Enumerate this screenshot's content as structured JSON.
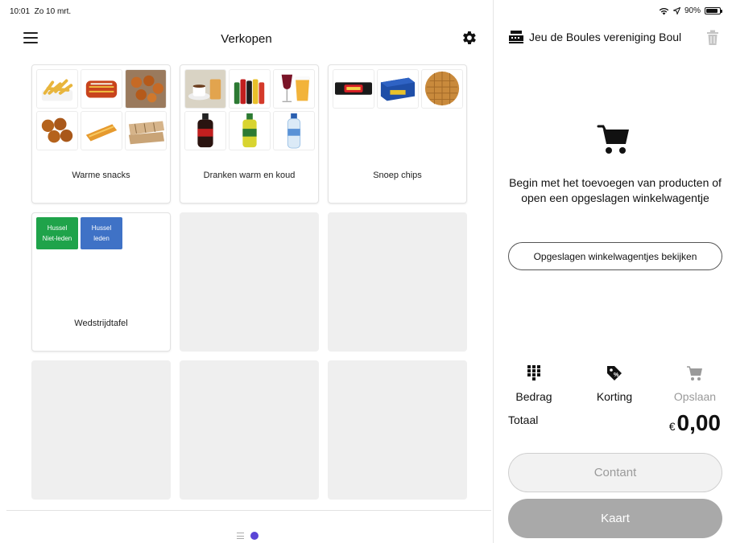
{
  "status_bar": {
    "time": "10:01",
    "date": "Zo 10 mrt.",
    "battery_text": "90%",
    "icons": [
      "wifi-icon",
      "location-arrow-icon",
      "battery-icon"
    ]
  },
  "header": {
    "title": "Verkopen",
    "menu_icon": "hamburger-icon",
    "settings_icon": "gear-icon"
  },
  "categories": [
    {
      "label": "Warme snacks",
      "thumbnails": [
        "fries",
        "frikandel-speciaal",
        "nuggets",
        "bitterballen",
        "kaassouffle",
        "tosti"
      ]
    },
    {
      "label": "Dranken warm en koud",
      "thumbnails": [
        "coffee-tea",
        "soda-bottles",
        "wine-beer",
        "cola-bottle",
        "water-bottle",
        "spa-water"
      ]
    },
    {
      "label": "Snoep chips",
      "thumbnails": [
        "mars-bar",
        "candy-box",
        "stroopwafel"
      ]
    },
    {
      "label": "Wedstrijdtafel",
      "buttons": [
        {
          "line1": "Hussel",
          "line2": "Niet-leden",
          "color": "#1fa34a"
        },
        {
          "line1": "Hussel",
          "line2": "leden",
          "color": "#3f72c6"
        }
      ]
    }
  ],
  "pager": {
    "icons": [
      "list-icon",
      "page-dot-icon"
    ],
    "active_color": "#5b45d6"
  },
  "register": {
    "name": "Jeu de Boules vereniging Boul",
    "register_icon": "cash-register-icon",
    "trash_icon": "trash-icon",
    "empty_message": "Begin met het toevoegen van producten of open een opgeslagen winkelwagentje",
    "saved_carts_button": "Opgeslagen winkelwagentjes bekijken",
    "actions": [
      {
        "label": "Bedrag",
        "icon": "keypad-icon",
        "enabled": true
      },
      {
        "label": "Korting",
        "icon": "discount-tag-icon",
        "enabled": true
      },
      {
        "label": "Opslaan",
        "icon": "cart-save-icon",
        "enabled": false
      }
    ],
    "total_label": "Totaal",
    "currency": "€",
    "total_amount": "0,00",
    "pay_cash": "Contant",
    "pay_card": "Kaart"
  }
}
